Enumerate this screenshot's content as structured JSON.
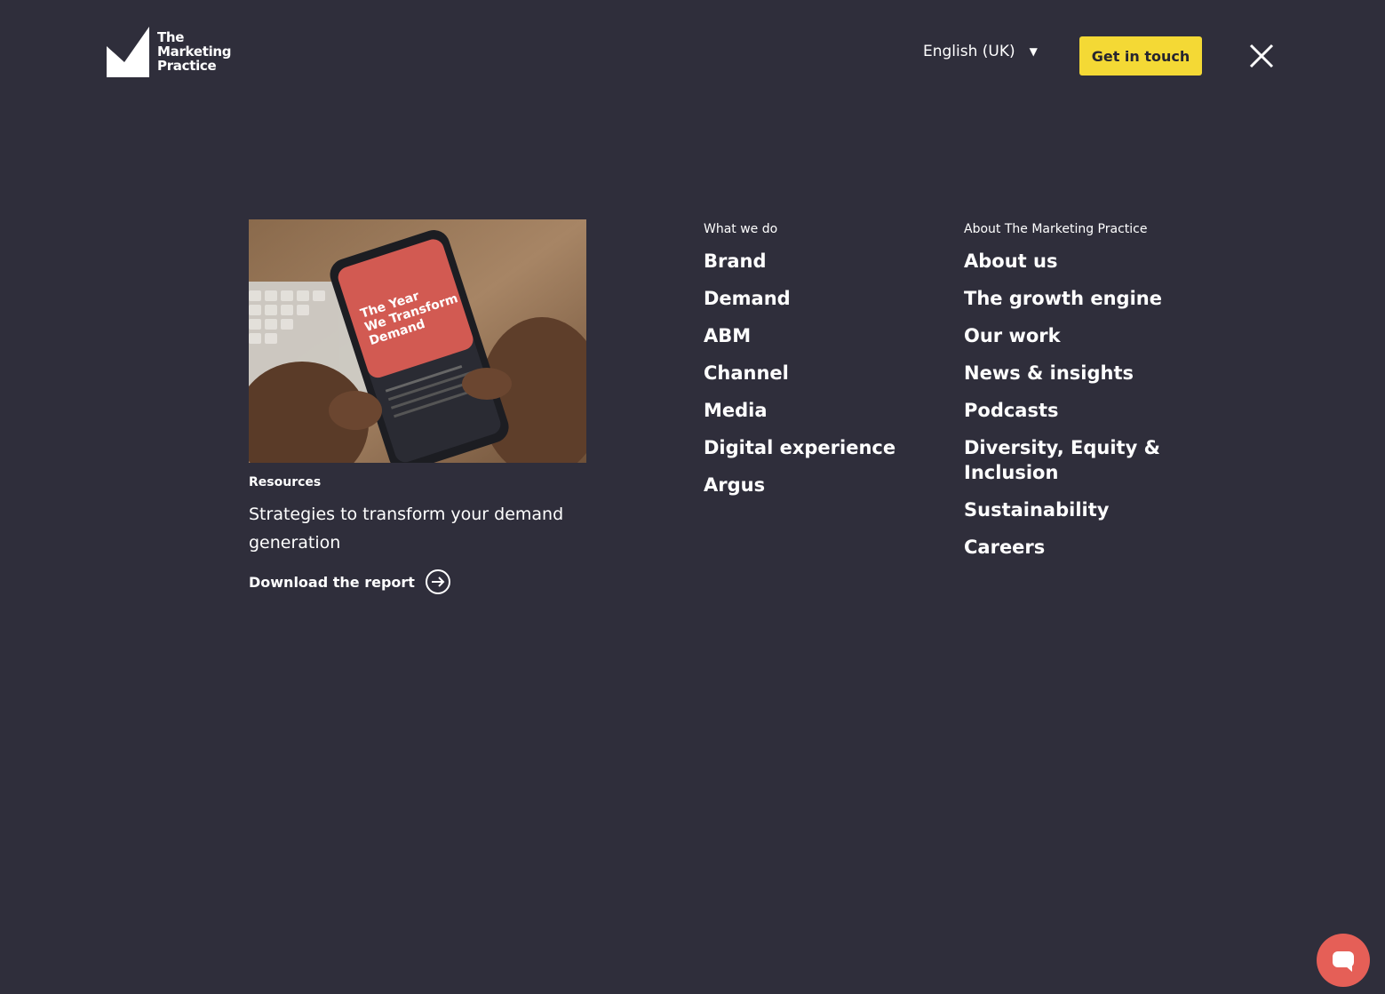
{
  "header": {
    "logo_lines": [
      "The",
      "Marketing",
      "Practice"
    ],
    "language": "English (UK)",
    "cta_label": "Get in touch",
    "close_icon": "close-icon"
  },
  "feature": {
    "image_text": "The Year We Transform Demand",
    "tag": "Resources",
    "title": "Strategies to transform your demand generation",
    "link_label": "Download the report"
  },
  "nav": {
    "what_we_do": {
      "heading": "What we do",
      "items": [
        "Brand",
        "Demand",
        "ABM",
        "Channel",
        "Media",
        "Digital experience",
        "Argus"
      ]
    },
    "about": {
      "heading": "About The Marketing Practice",
      "items": [
        "About us",
        "The growth engine",
        "Our work",
        "News & insights",
        "Podcasts",
        "Diversity, Equity & Inclusion",
        "Sustainability",
        "Careers"
      ]
    }
  },
  "colors": {
    "background": "#2f2e3b",
    "accent": "#f4d935",
    "chat": "#e55f57"
  }
}
